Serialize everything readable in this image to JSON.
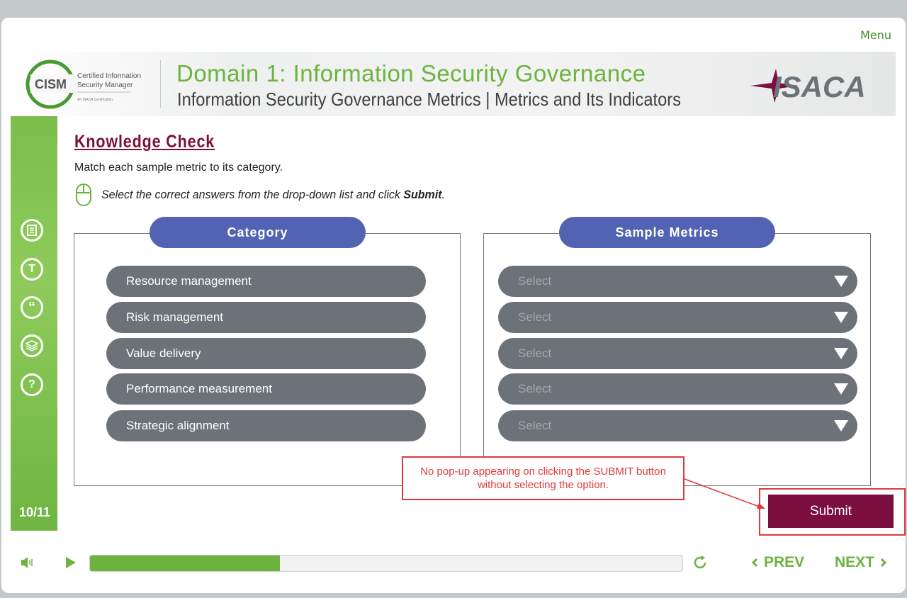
{
  "header": {
    "menu_label": "Menu",
    "domain_title": "Domain 1: Information Security Governance",
    "sub_title": "Information Security Governance Metrics | Metrics and Its Indicators",
    "cism_logo": {
      "abbr": "CISM",
      "line1": "Certified Information",
      "line2": "Security Manager",
      "line3": "An ISACA Certification"
    },
    "isaca_logo": "ISACA"
  },
  "sidebar": {
    "icons": [
      "document-icon",
      "glossary-t-icon",
      "quote-icon",
      "layers-icon",
      "help-icon"
    ],
    "glossary_glyph": "T",
    "quote_glyph": "“",
    "help_glyph": "?",
    "page_count": "10/11"
  },
  "main": {
    "title": "Knowledge Check",
    "instruction": "Match each sample metric to its category.",
    "hint_prefix": "Select the correct answers from the drop-down list and click ",
    "hint_bold": "Submit",
    "hint_suffix": "."
  },
  "category_panel": {
    "header": "Category",
    "items": [
      "Resource management",
      "Risk management",
      "Value delivery",
      "Performance measurement",
      "Strategic alignment"
    ]
  },
  "metrics_panel": {
    "header": "Sample Metrics",
    "selects": [
      "Select",
      "Select",
      "Select",
      "Select",
      "Select"
    ]
  },
  "callout": {
    "text": "No pop-up appearing on clicking the SUBMIT button without selecting the option."
  },
  "submit_label": "Submit",
  "footer": {
    "progress": 0.32,
    "prev_label": "PREV",
    "next_label": "NEXT"
  },
  "colors": {
    "accent_green": "#6cb33f",
    "header_blue": "#5163b2",
    "pill_gray": "#6c7277",
    "submit_maroon": "#7b0f40",
    "callout_red": "#e0393b"
  }
}
